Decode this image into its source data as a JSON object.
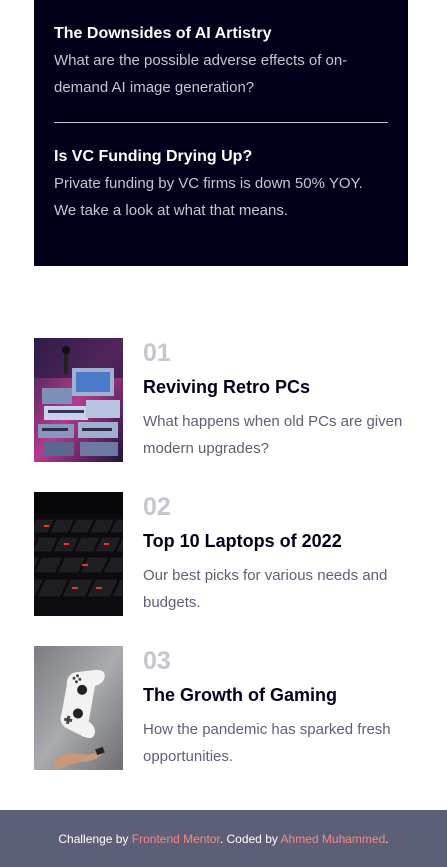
{
  "new_section": {
    "items": [
      {
        "title": "The Downsides of AI Artistry",
        "description": "What are the possible adverse effects of on-demand AI image generation?"
      },
      {
        "title": "Is VC Funding Drying Up?",
        "description": "Private funding by VC firms is down 50% YOY. We take a look at what that means."
      }
    ]
  },
  "articles": [
    {
      "number": "01",
      "title": "Reviving Retro PCs",
      "description": "What happens when old PCs are given modern upgrades?",
      "image": "retro-pc-image"
    },
    {
      "number": "02",
      "title": "Top 10 Laptops of 2022",
      "description": "Our best picks for various needs and budgets.",
      "image": "laptop-keyboard-image"
    },
    {
      "number": "03",
      "title": "The Growth of Gaming",
      "description": "How the pandemic has sparked fresh opportunities.",
      "image": "gamepad-image"
    }
  ],
  "footer": {
    "prefix": "Challenge by ",
    "link1": "Frontend Mentor",
    "middle": ". Coded by ",
    "link2": "Ahmed Muhammed",
    "suffix": "."
  },
  "colors": {
    "dark_navy": "#00001a",
    "grayish_blue": "#5d5f79",
    "grayish_blue_light": "#c5c6ce",
    "soft_red": "#f08b7f"
  }
}
